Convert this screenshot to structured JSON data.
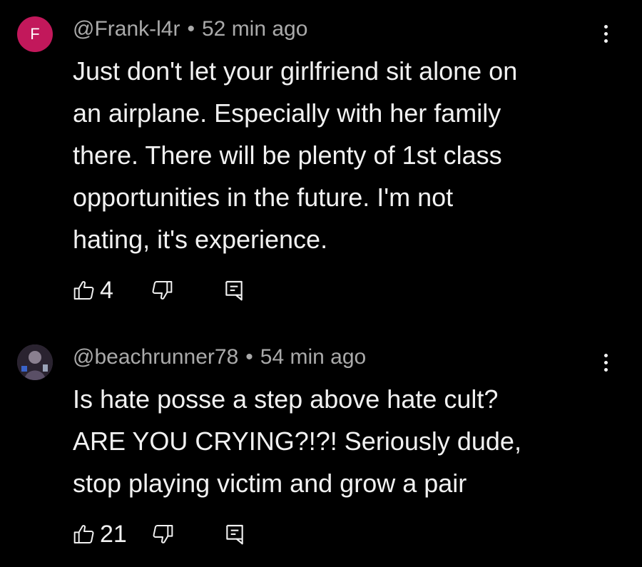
{
  "comments": [
    {
      "avatar_letter": "F",
      "avatar_color": "#c2185b",
      "handle": "@Frank-l4r",
      "separator": "•",
      "time": "52 min ago",
      "text": "Just don't let your girlfriend sit alone on\nan airplane. Especially with her family\nthere.  There will be plenty of 1st class\nopportunities in the future.  I'm not\nhating, it's experience.",
      "likes": "4",
      "icons": [
        "thumbs-up-icon",
        "thumbs-down-icon",
        "reply-icon",
        "more-vert-icon"
      ]
    },
    {
      "avatar_letter": "",
      "handle": "@beachrunner78",
      "separator": "•",
      "time": "54 min ago",
      "text": "Is hate posse a step above hate cult?\nARE YOU CRYING?!?! Seriously dude,\nstop playing victim and grow a pair",
      "likes": "21",
      "icons": [
        "thumbs-up-icon",
        "thumbs-down-icon",
        "reply-icon",
        "more-vert-icon"
      ]
    }
  ],
  "colors": {
    "background": "#000000",
    "text": "#f1f1f1",
    "meta": "#aaaaaa"
  }
}
